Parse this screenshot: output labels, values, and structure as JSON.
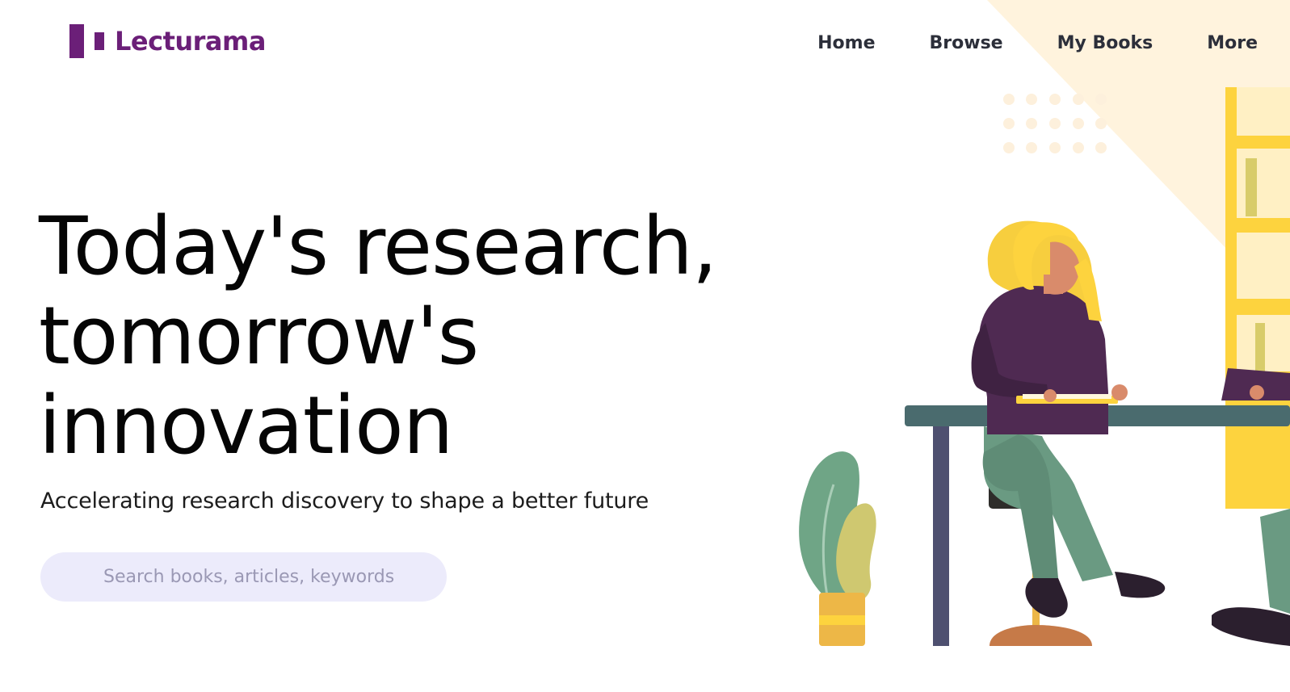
{
  "brand": {
    "name": "Lecturama",
    "color": "#6b1f78"
  },
  "nav": {
    "items": [
      {
        "label": "Home"
      },
      {
        "label": "Browse"
      },
      {
        "label": "My Books"
      },
      {
        "label": "More"
      }
    ],
    "color": "#2c2f3a"
  },
  "hero": {
    "headline_lines": [
      "Today's research,",
      "tomorrow's",
      "innovation"
    ],
    "subtitle": "Accelerating research discovery to shape a better future",
    "search": {
      "placeholder": "Search books, articles, keywords",
      "value": "",
      "background": "#ecebfb"
    }
  },
  "illustration": {
    "subject": "woman-reading-at-desk-illustration",
    "colors": {
      "sweater": "#4f2a52",
      "hair": "#f7ce3e",
      "pants": "#6a9a82",
      "desk": "#4a6b6e",
      "shelf": "#fdd33e",
      "plant": "#6fa586",
      "pot": "#f2c040",
      "light": "#fff3dd"
    }
  }
}
